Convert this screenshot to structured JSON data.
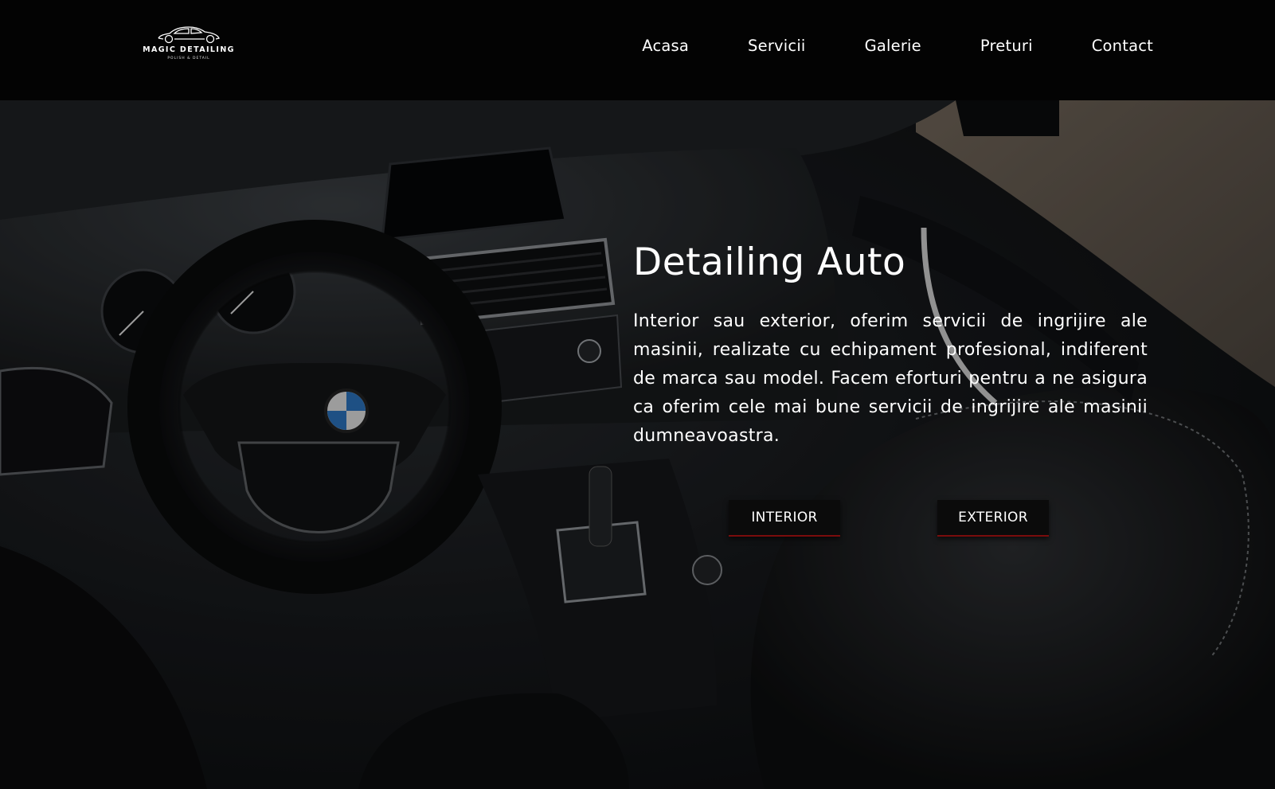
{
  "header": {
    "logo": {
      "name": "MAGIC DETAILING",
      "tagline": "POLISH & DETAIL"
    },
    "nav": [
      {
        "label": "Acasa"
      },
      {
        "label": "Servicii"
      },
      {
        "label": "Galerie"
      },
      {
        "label": "Preturi"
      },
      {
        "label": "Contact"
      }
    ]
  },
  "hero": {
    "title": "Detailing Auto",
    "text": "Interior sau exterior, oferim servicii de ingrijire ale masinii, realizate cu echipament profesional, indiferent de marca sau model. Facem eforturi pentru a ne asigura ca oferim cele mai bune servicii de ingrijire ale masinii dumneavoastra.",
    "buttons": {
      "interior": "INTERIOR",
      "exterior": "EXTERIOR"
    },
    "background_description_icon": "car-interior-photo"
  },
  "colors": {
    "header_bg": "#030303",
    "button_bg": "#0b0b0b",
    "button_accent": "#7a0c0c",
    "text": "#ffffff"
  }
}
